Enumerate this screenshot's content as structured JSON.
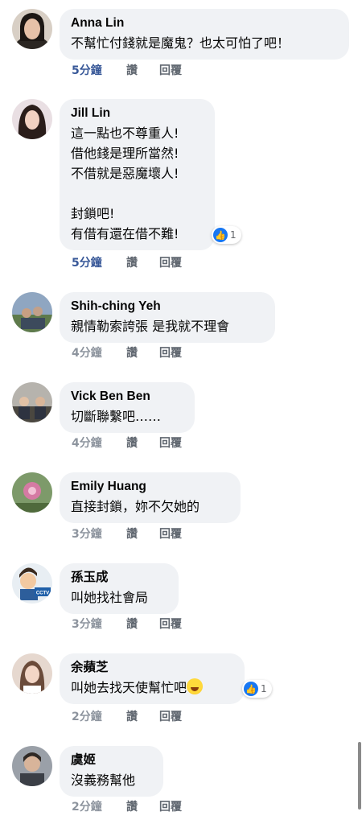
{
  "actions": {
    "like": "讚",
    "reply": "回覆"
  },
  "comments": [
    {
      "name": "Anna Lin",
      "text": "不幫忙付錢就是魔鬼？也太可怕了吧！",
      "time": "5分鐘",
      "avatar": "woman-portrait-avatar"
    },
    {
      "name": "Jill Lin",
      "text": "這一點也不尊重人!\n借他錢是理所當然!\n不借就是惡魔壞人!\n\n封鎖吧!\n有借有還在借不難!",
      "time": "5分鐘",
      "reactions": "1",
      "avatar": "woman-long-hair-avatar"
    },
    {
      "name": "Shih-ching Yeh",
      "text": "親情勒索誇張 是我就不理會",
      "time": "4分鐘",
      "avatar": "outdoor-photo-avatar"
    },
    {
      "name": "Vick Ben Ben",
      "text": "切斷聯繫吧……",
      "time": "4分鐘",
      "avatar": "people-photo-avatar"
    },
    {
      "name": "Emily Huang",
      "text": "直接封鎖，妳不欠她的",
      "time": "3分鐘",
      "avatar": "flower-avatar"
    },
    {
      "name": "孫玉成",
      "text": "叫她找社會局",
      "time": "3分鐘",
      "avatar": "cartoon-avatar",
      "badge": "CCTV"
    },
    {
      "name": "余蘋芝",
      "text": "叫她去找天使幫忙吧",
      "time": "2分鐘",
      "reactions": "1",
      "emoji": "rolling-laughing-emoji",
      "avatar": "woman-avatar"
    },
    {
      "name": "虞姬",
      "text": "沒義務幫他",
      "time": "2分鐘",
      "avatar": "portrait-avatar"
    }
  ],
  "colors": {
    "bubble": "#f0f2f5",
    "link_blue": "#385898",
    "like_blue": "#1877f2"
  }
}
